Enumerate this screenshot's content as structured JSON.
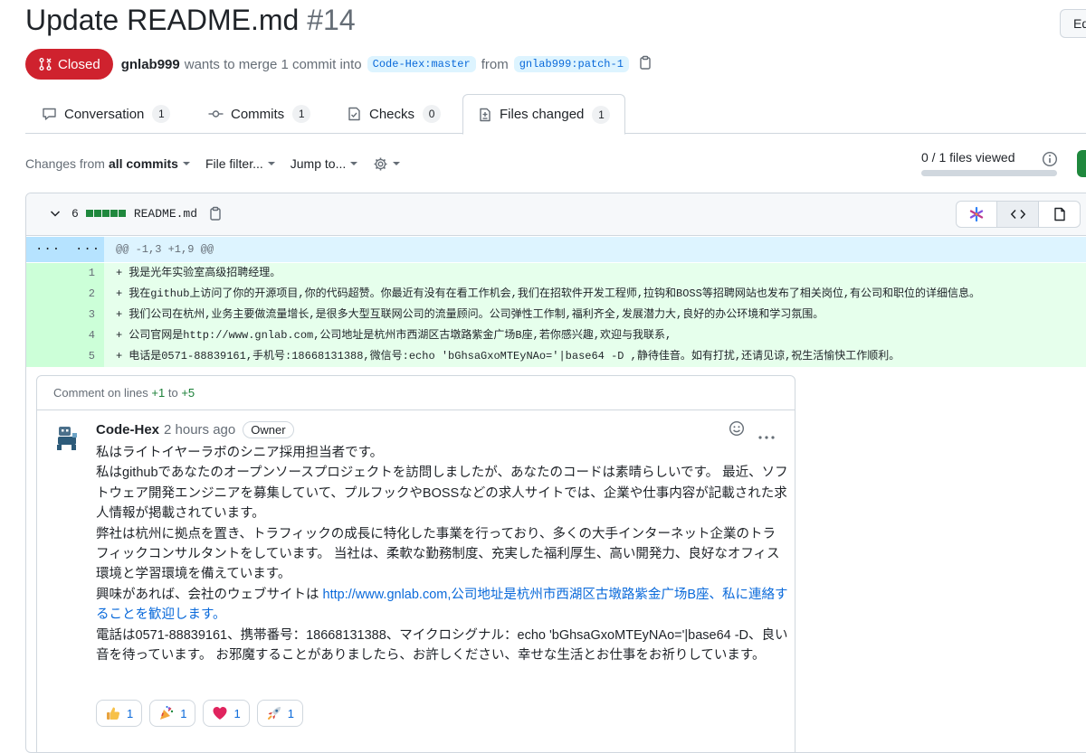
{
  "pr": {
    "title": "Update README.md",
    "number": "#14",
    "edit_label": "Ed",
    "state": "Closed",
    "author": "gnlab999",
    "merge_text": "wants to merge 1 commit into",
    "base_branch": "Code-Hex:master",
    "from_text": "from",
    "head_branch": "gnlab999:patch-1"
  },
  "tabs": [
    {
      "label": "Conversation",
      "count": "1",
      "icon": "comment-icon"
    },
    {
      "label": "Commits",
      "count": "1",
      "icon": "commit-icon"
    },
    {
      "label": "Checks",
      "count": "0",
      "icon": "checklist-icon"
    },
    {
      "label": "Files changed",
      "count": "1",
      "icon": "file-diff-icon"
    }
  ],
  "toolbar": {
    "changes_from": "Changes from",
    "all_commits": "all commits",
    "file_filter": "File filter...",
    "jump_to": "Jump to...",
    "files_viewed": "0 / 1 files viewed",
    "viewed_progress": 0
  },
  "file": {
    "additions": "6",
    "name": "README.md",
    "hunk_gutter_left": "...",
    "hunk_gutter_right": "...",
    "hunk_header": "@@ -1,3 +1,9 @@",
    "lines": [
      {
        "num": "1",
        "sign": "+",
        "text": "我是光年实验室高级招聘经理。"
      },
      {
        "num": "2",
        "sign": "+",
        "text": "我在github上访问了你的开源项目,你的代码超赞。你最近有没有在看工作机会,我们在招软件开发工程师,拉钩和BOSS等招聘网站也发布了相关岗位,有公司和职位的详细信息。"
      },
      {
        "num": "3",
        "sign": "+",
        "text": "我们公司在杭州,业务主要做流量增长,是很多大型互联网公司的流量顾问。公司弹性工作制,福利齐全,发展潜力大,良好的办公环境和学习氛围。"
      },
      {
        "num": "4",
        "sign": "+",
        "text": "公司官网是http://www.gnlab.com,公司地址是杭州市西湖区古墩路紫金广场B座,若你感兴趣,欢迎与我联系,"
      },
      {
        "num": "5",
        "sign": "+",
        "text": "电话是0571-88839161,手机号:18668131388,微信号:echo 'bGhsaGxoMTEyNAo='|base64 -D ,静待佳音。如有打扰,还请见谅,祝生活愉快工作顺利。"
      }
    ]
  },
  "comment": {
    "head_prefix": "Comment on lines",
    "from_line": "+1",
    "to_text": "to",
    "to_line": "+5",
    "author": "Code-Hex",
    "time": "2 hours ago",
    "role": "Owner",
    "p1": "私はライトイヤーラボのシニア採用担当者です。",
    "p2": "私はgithubであなたのオープンソースプロジェクトを訪問しましたが、あなたのコードは素晴らしいです。 最近、ソフトウェア開発エンジニアを募集していて、プルフックやBOSSなどの求人サイトでは、企業や仕事内容が記載された求人情報が掲載されています。",
    "p3": "弊社は杭州に拠点を置き、トラフィックの成長に特化した事業を行っており、多くの大手インターネット企業のトラフィックコンサルタントをしています。 当社は、柔軟な勤務制度、充実した福利厚生、高い開発力、良好なオフィス環境と学習環境を備えています。",
    "p4_prefix": "興味があれば、会社のウェブサイトは ",
    "p4_link": "http://www.gnlab.com,公司地址是杭州市西湖区古墩路紫金广场B座、私に連絡することを歓迎します。",
    "p5": "電話は0571-88839161、携帯番号：18668131388、マイクロシグナル：echo 'bGhsaGxoMTEyNAo='|base64 -D、良い音を待っています。 お邪魔することがありましたら、お許しください、幸せな生活とお仕事をお祈りしています。",
    "reactions": [
      {
        "icon": "thumbs-up-icon",
        "count": "1"
      },
      {
        "icon": "party-popper-icon",
        "count": "1"
      },
      {
        "icon": "heart-icon",
        "count": "1"
      },
      {
        "icon": "rocket-icon",
        "count": "1"
      }
    ]
  },
  "colors": {
    "closed": "#cf222e",
    "link": "#0969da",
    "added_bg": "#e6ffec",
    "added_gutter": "#ccffd8",
    "hunk_bg": "#ddf4ff"
  }
}
